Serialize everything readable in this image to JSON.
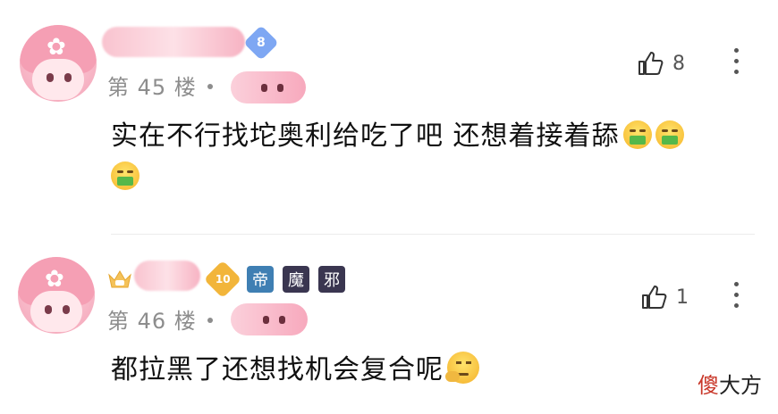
{
  "comments": [
    {
      "level": "8",
      "floor": "第 45 楼",
      "likes": "8",
      "text": "实在不行找坨奥利给吃了吧 还想着接着舔"
    },
    {
      "level": "10",
      "floor": "第 46 楼",
      "likes": "1",
      "text": "都拉黑了还想找机会复合呢",
      "badges": [
        "帝",
        "魔",
        "邪"
      ]
    }
  ],
  "watermark": {
    "char1": "傻",
    "rest": "大方"
  },
  "colors": {
    "level_badge_1": "#7ea7f3",
    "level_badge_2": "#f2b53a",
    "badge_blue": "#3f7fb3",
    "badge_dark": "#3a3650"
  },
  "icons": [
    "thumbs-up-icon",
    "more-icon",
    "crown-icon",
    "level-badge-icon"
  ]
}
